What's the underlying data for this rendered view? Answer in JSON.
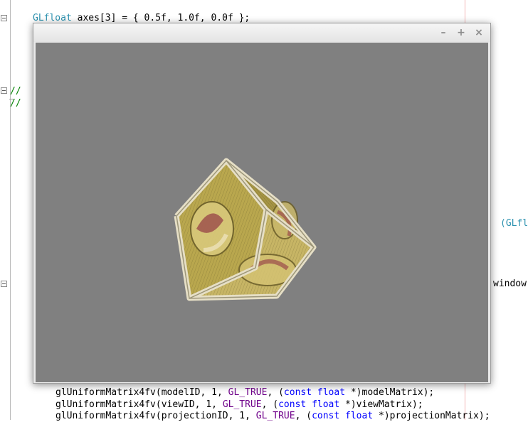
{
  "editor": {
    "lines": {
      "axes": "GLfloat axes[3] = { 0.5f, 1.0f, 0.0f };",
      "comment_1": "//",
      "comment_2": "//",
      "model": "glUniformMatrix4fv(modelID, 1, GL_TRUE, (const float *)modelMatrix);",
      "view": "glUniformMatrix4fv(viewID, 1, GL_TRUE, (const float *)viewMatrix);",
      "projection": "glUniformMatrix4fv(projectionID, 1, GL_TRUE, (const float *)projectionMatrix);"
    },
    "right_fragments": {
      "glfloat": "(GLfl",
      "window": "window"
    },
    "axes_parts": {
      "type": "GLfloat",
      "rest": " axes[3] = { 0.5f, 1.0f, 0.0f };"
    },
    "model_parts": {
      "fn": "glUniformMatrix4fv",
      "a": "(modelID, 1, ",
      "macro": "GL_TRUE",
      "b": ", (",
      "k1": "const",
      "sp": " ",
      "k2": "float",
      "c": " *)modelMatrix);"
    },
    "view_parts": {
      "fn": "glUniformMatrix4fv",
      "a": "(viewID, 1, ",
      "macro": "GL_TRUE",
      "b": ", (",
      "k1": "const",
      "sp": " ",
      "k2": "float",
      "c": " *)viewMatrix);"
    },
    "proj_parts": {
      "fn": "glUniformMatrix4fv",
      "a": "(projectionID, 1, ",
      "macro": "GL_TRUE",
      "b": ", (",
      "k1": "const",
      "sp": " ",
      "k2": "float",
      "c": " *)projectionMatrix);"
    }
  },
  "window": {
    "title": "",
    "minimize_glyph": "–",
    "maximize_glyph": "+",
    "close_glyph": "×",
    "viewport_color": "#808080"
  },
  "scene": {
    "object": "textured crate cube",
    "face_colors": [
      "#b9a74e",
      "#a69544",
      "#c7b565"
    ],
    "edge_color": "#e6dfc6"
  }
}
